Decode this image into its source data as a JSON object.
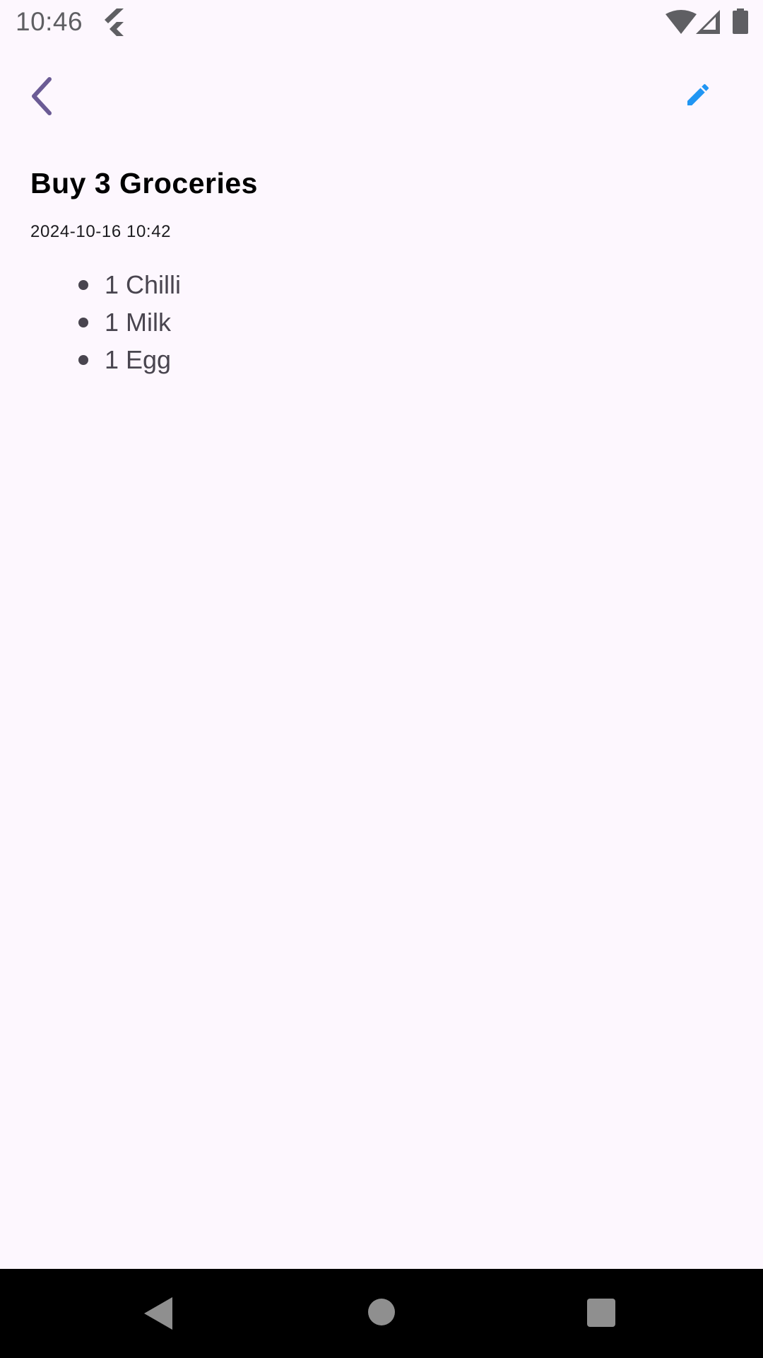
{
  "status_bar": {
    "time": "10:46",
    "icons": [
      "flutter-icon",
      "wifi-icon",
      "signal-icon",
      "battery-icon"
    ]
  },
  "app_bar": {
    "back_icon": "chevron-left-icon",
    "edit_icon": "pencil-icon"
  },
  "note": {
    "title": "Buy 3 Groceries",
    "date": "2024-10-16 10:42",
    "items": [
      "1 Chilli",
      "1 Milk",
      "1 Egg"
    ]
  },
  "nav_bar": {
    "icons": [
      "nav-back-icon",
      "nav-home-icon",
      "nav-recents-icon"
    ]
  },
  "colors": {
    "background": "#fdf7fe",
    "back_icon": "#6b5b95",
    "edit_icon": "#2196f3",
    "text_primary": "#000000",
    "text_secondary": "#49454f"
  }
}
